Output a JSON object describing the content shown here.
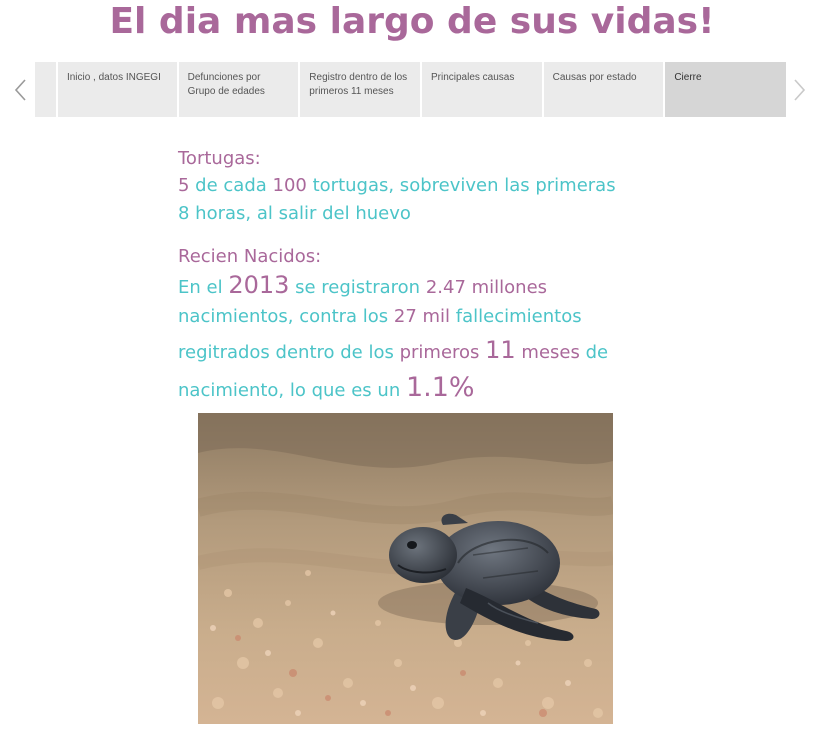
{
  "page": {
    "title": "El dia mas largo de sus vidas!"
  },
  "tabs": [
    {
      "label": "Inicio , datos INGEGI"
    },
    {
      "label": "Defunciones por Grupo de edades"
    },
    {
      "label": "Registro dentro de los primeros 11 meses"
    },
    {
      "label": "Principales causas"
    },
    {
      "label": "Causas por estado"
    },
    {
      "label": "Cierre"
    }
  ],
  "active_tab": "Cierre",
  "turtles": {
    "heading": "Tortugas:",
    "n1": "5",
    "t1": " de cada ",
    "n2": "100",
    "t2": " tortugas, sobreviven las primeras",
    "t3": "8 horas, al salir del huevo"
  },
  "newborns": {
    "heading": "Recien Nacidos:",
    "t1": "En el ",
    "year": "2013",
    "t2": " se registraron ",
    "births": "2.47 millones",
    "t3": "nacimientos, contra los ",
    "deaths": "27 mil",
    "t4": " fallecimientos",
    "t5": "regitrados dentro de los ",
    "w1": "primeros",
    "months": "11",
    "w2": " meses",
    "t6": " de",
    "t7": "nacimiento, lo que es un ",
    "pct": "1.1%"
  },
  "icons": {
    "prev": "chevron-left-icon",
    "next": "chevron-right-icon"
  },
  "colors": {
    "accent_pink": "#a9689a",
    "accent_teal": "#4cc4c8",
    "tab_bg": "#ebebeb",
    "tab_active_bg": "#d6d6d6"
  }
}
